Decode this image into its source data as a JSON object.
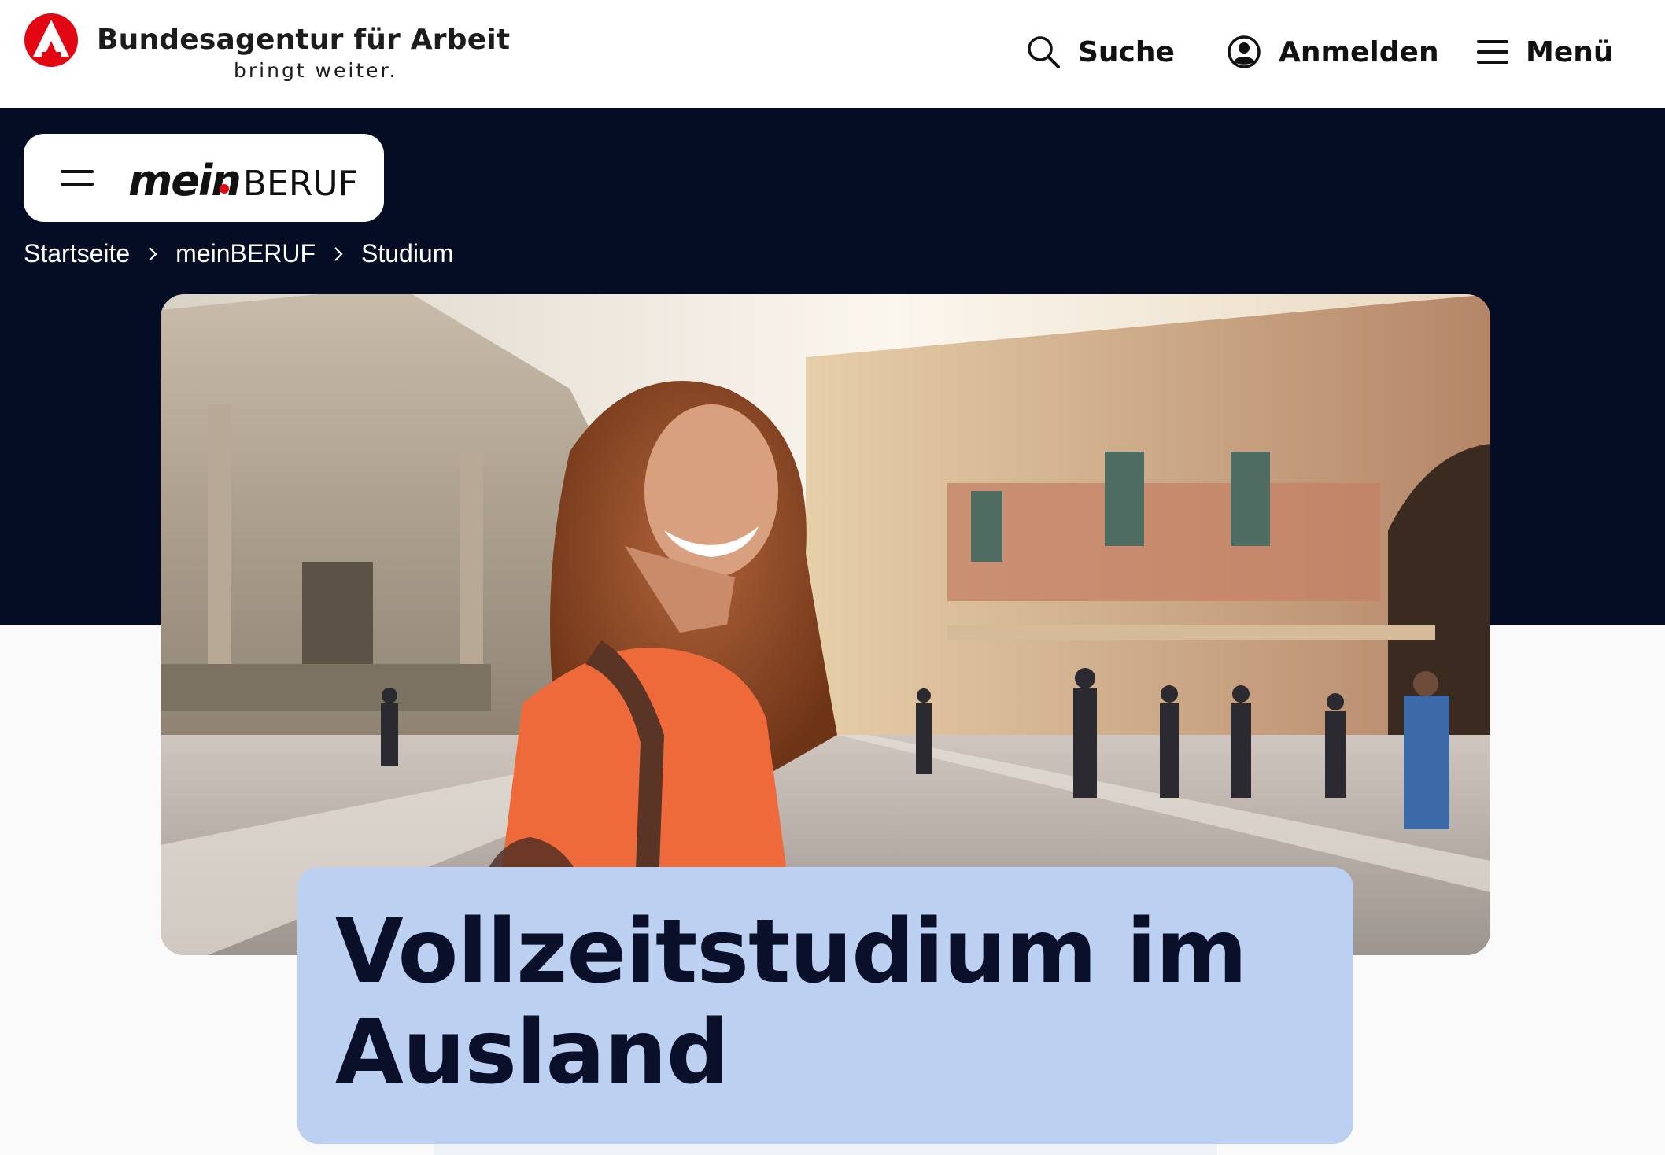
{
  "header": {
    "brand_title": "Bundesagentur für Arbeit",
    "brand_tagline": "bringt weiter.",
    "brand_color": "#e30613",
    "nav": {
      "search_label": "Suche",
      "login_label": "Anmelden",
      "menu_label": "Menü"
    },
    "icons": {
      "search": "search-icon",
      "login": "user-circle-icon",
      "menu": "hamburger-menu-icon"
    }
  },
  "section": {
    "brand_prefix": "mein",
    "brand_suffix": "BERUF",
    "menu_icon": "hamburger-menu-icon",
    "band_color": "#040d23"
  },
  "breadcrumb": {
    "items": [
      "Startseite",
      "meinBERUF",
      "Studium"
    ]
  },
  "hero": {
    "title": "Vollzeitstudium im Ausland",
    "card_color": "#bcd0f2"
  }
}
